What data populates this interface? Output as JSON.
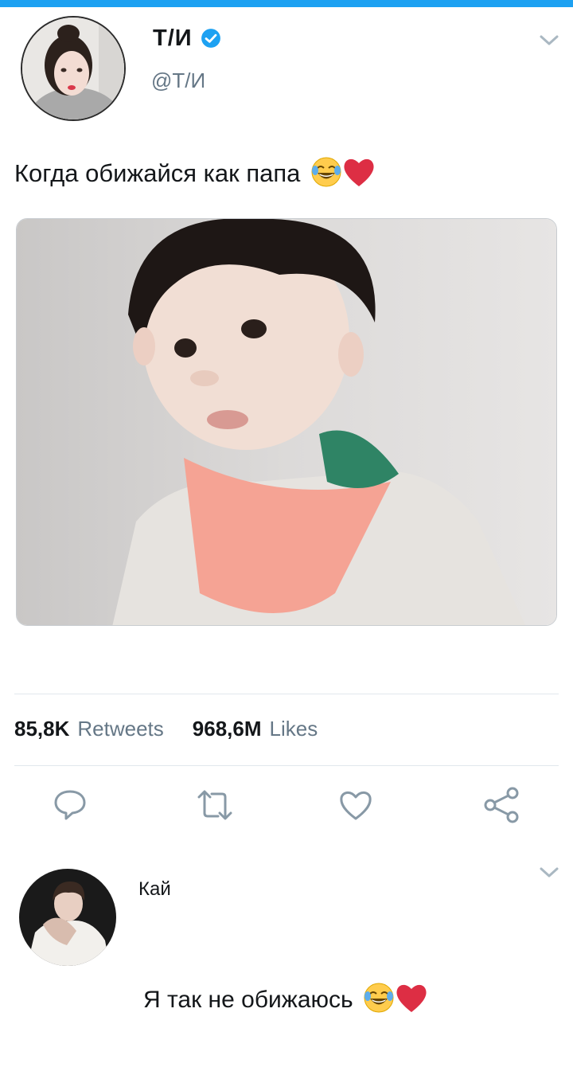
{
  "tweet": {
    "author_name": "Т/И",
    "author_handle": "@Т/И",
    "text": "Когда обижайся как папа",
    "text_emojis": [
      "face-with-tears-of-joy-emoji",
      "red-heart-emoji"
    ],
    "retweets_count": "85,8K",
    "retweets_label": "Retweets",
    "likes_count": "968,6M",
    "likes_label": "Likes"
  },
  "actions": [
    {
      "name": "reply-icon"
    },
    {
      "name": "retweet-icon"
    },
    {
      "name": "like-icon"
    },
    {
      "name": "share-icon"
    }
  ],
  "reply": {
    "author_name": "Кай",
    "text": "Я так не обижаюсь",
    "text_emojis": [
      "face-with-tears-of-joy-emoji",
      "red-heart-emoji"
    ]
  },
  "colors": {
    "accent": "#1da1f2",
    "secondary_text": "#657786",
    "heart": "#e0245e"
  }
}
